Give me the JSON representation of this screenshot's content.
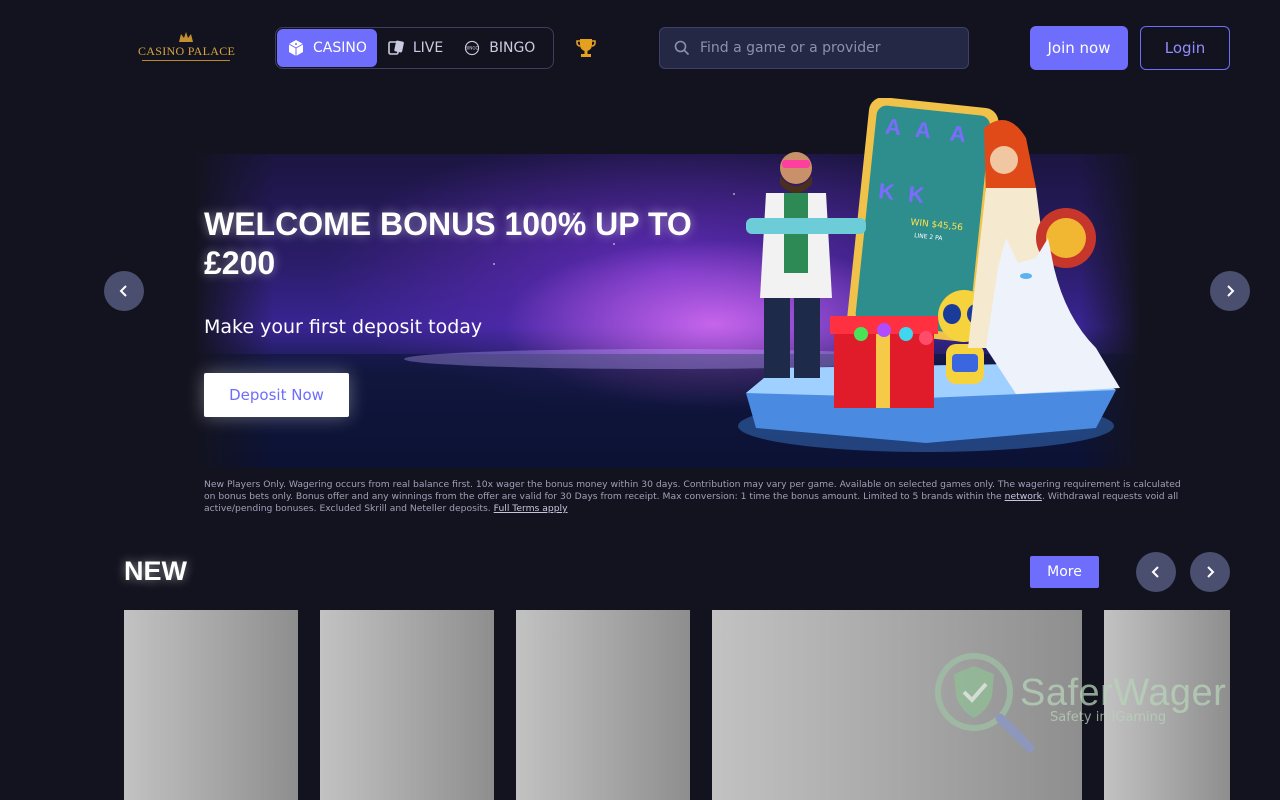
{
  "header": {
    "logo_text": "CASINO PALACE",
    "tabs": [
      {
        "label": "CASINO",
        "icon": "dice-icon",
        "active": true
      },
      {
        "label": "LIVE",
        "icon": "cards-icon",
        "active": false
      },
      {
        "label": "BINGO",
        "icon": "bingo-ball-icon",
        "active": false
      }
    ],
    "trophy_icon": "trophy-icon",
    "search": {
      "placeholder": "Find a game or a provider",
      "icon": "search-icon"
    },
    "join_label": "Join now",
    "login_label": "Login"
  },
  "banner": {
    "title": "WELCOME BONUS 100% UP TO £200",
    "subtitle": "Make your first deposit today",
    "cta_label": "Deposit Now",
    "terms_text": "New Players Only. Wagering occurs from real balance first. 10x wager the bonus money within 30 days. Contribution may vary per game. Available on selected games only. The wagering requirement is calculated on bonus bets only. Bonus offer and any winnings from the offer are valid for 30 Days from receipt. Max conversion: 1 time the bonus amount. Limited to 5 brands within the ",
    "terms_link_network": "network",
    "terms_text_2": ". Withdrawal requests void all active/pending bonuses. Excluded Skrill and Neteller deposits. ",
    "terms_link_full": "Full Terms apply",
    "slot_win_text": "WIN $45,56",
    "slot_line_text": "LINE 2 PA"
  },
  "new_section": {
    "title": "NEW",
    "more_label": "More"
  },
  "watermark": {
    "brand": "SaferWager",
    "tagline": "Safety in iGaming"
  },
  "colors": {
    "background": "#13131f",
    "accent": "#6e6dfc",
    "logo_gold": "#d6a640"
  }
}
